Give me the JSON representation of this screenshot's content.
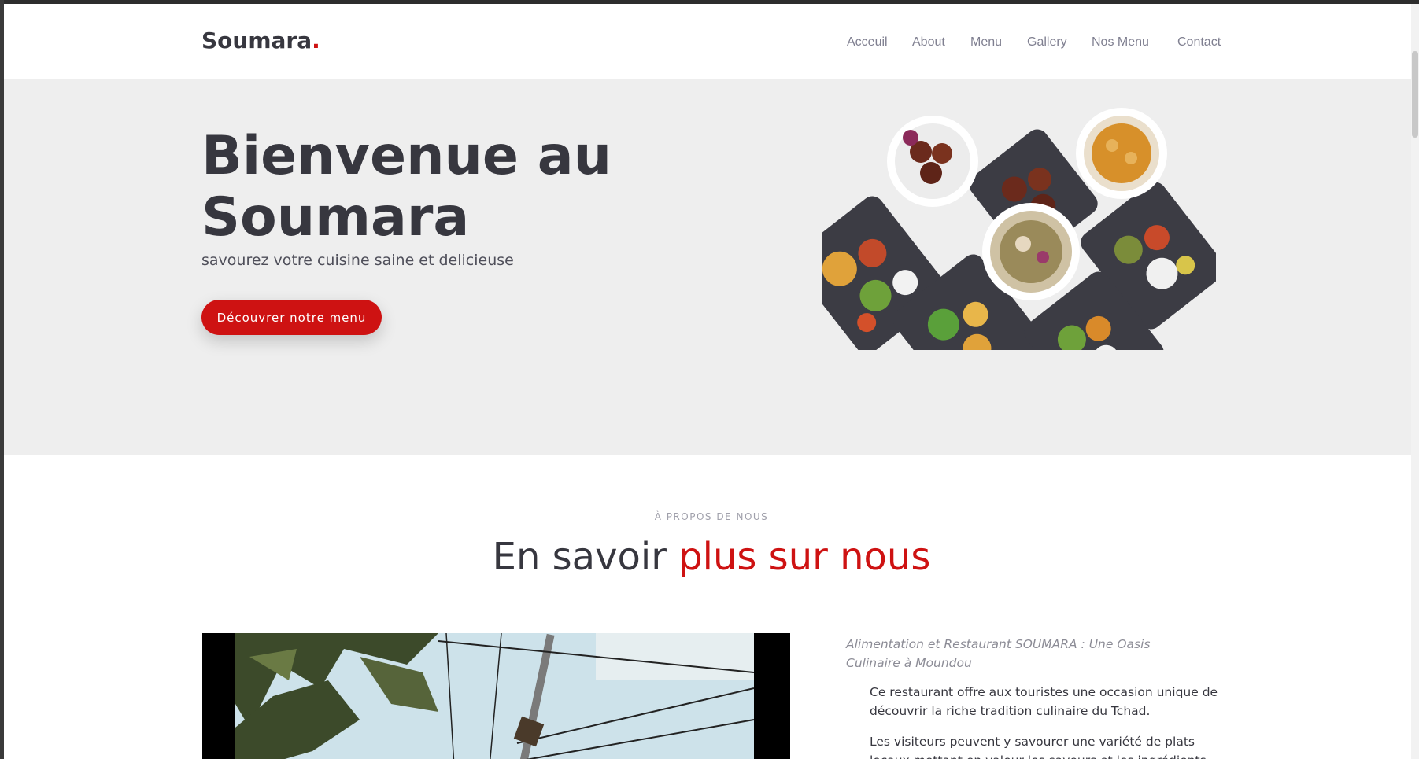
{
  "brand": {
    "name": "Soumara",
    "dot": "."
  },
  "nav": {
    "items": [
      {
        "label": "Acceuil"
      },
      {
        "label": "About"
      },
      {
        "label": "Menu"
      },
      {
        "label": "Gallery"
      },
      {
        "label": "Nos Menu"
      },
      {
        "label": "Contact"
      }
    ]
  },
  "hero": {
    "title": "Bienvenue au Soumara",
    "subtitle": "savourez votre cuisine saine et delicieuse",
    "cta": "Découvrer notre menu"
  },
  "about": {
    "kicker": "À PROPOS DE NOUS",
    "title_main": "En savoir ",
    "title_accent": "plus sur nous",
    "intro": "Alimentation et Restaurant SOUMARA : Une Oasis Culinaire à Moundou",
    "paragraphs": [
      "Ce restaurant offre aux touristes une occasion unique de découvrir la riche tradition culinaire du Tchad.",
      "Les visiteurs peuvent y savourer une variété de plats locaux mettant en valeur les saveurs et les ingrédients typiques de la"
    ]
  },
  "colors": {
    "accent": "#ce1212",
    "dark": "#37373f",
    "hero_bg": "#eeeeee"
  }
}
